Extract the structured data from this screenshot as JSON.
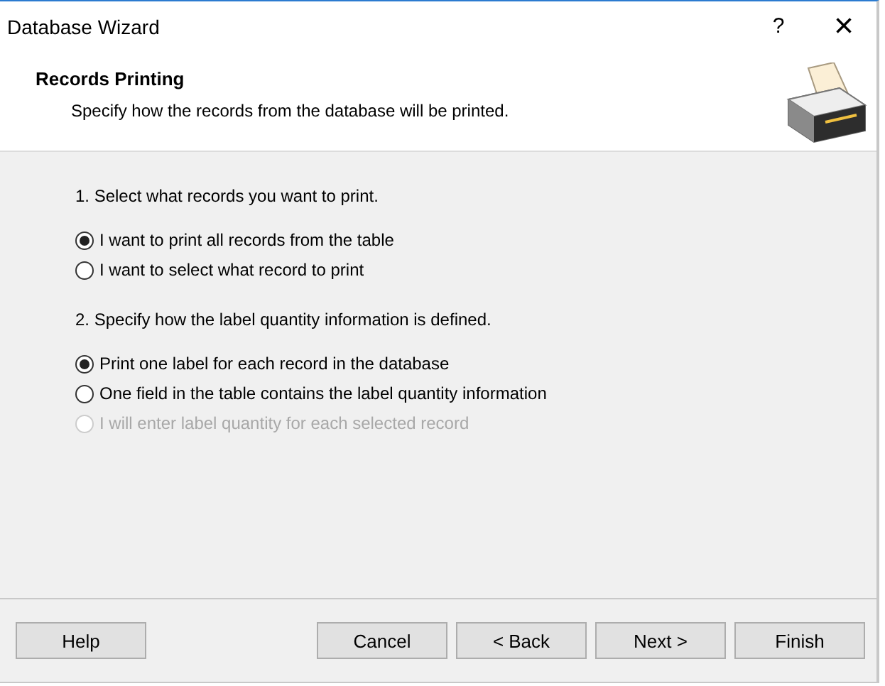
{
  "window": {
    "title": "Database Wizard",
    "help": "?",
    "close": "×"
  },
  "header": {
    "title": "Records Printing",
    "subtitle": "Specify how the records from the database will be printed."
  },
  "sections": [
    {
      "heading": "1. Select what records you want to print.",
      "options": [
        {
          "label": "I want to print all records from the table",
          "selected": true,
          "disabled": false
        },
        {
          "label": "I want to select what record to print",
          "selected": false,
          "disabled": false
        }
      ]
    },
    {
      "heading": "2. Specify how the label quantity information is defined.",
      "options": [
        {
          "label": "Print one label for each record in the database",
          "selected": true,
          "disabled": false
        },
        {
          "label": "One field in the table contains the label quantity information",
          "selected": false,
          "disabled": false
        },
        {
          "label": "I will enter label quantity for each selected record",
          "selected": false,
          "disabled": true
        }
      ]
    }
  ],
  "buttons": {
    "help": "Help",
    "actions": [
      "Cancel",
      "< Back",
      "Next >",
      "Finish"
    ]
  }
}
